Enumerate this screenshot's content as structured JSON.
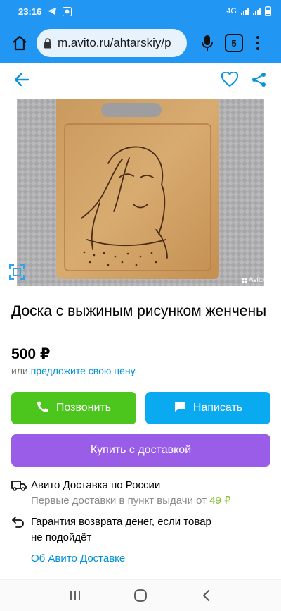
{
  "status_bar": {
    "time": "23:16",
    "network": "4G",
    "icons": [
      "telegram-icon",
      "avito-notification-icon",
      "signal-icon",
      "battery-icon"
    ]
  },
  "browser": {
    "url": "m.avito.ru/ahtarskiy/p",
    "tab_count": "5",
    "icons": [
      "home-icon",
      "lock-icon",
      "mic-icon",
      "tabs-icon",
      "menu-icon"
    ]
  },
  "header": {
    "icons": [
      "back-arrow-icon",
      "heart-icon",
      "share-icon"
    ]
  },
  "photo": {
    "watermark": "Avito",
    "icons": [
      "gallery-expand-icon"
    ]
  },
  "listing": {
    "title": "Доска с выжиным рисунком женчены",
    "price": "500 ₽",
    "offer_prefix": "или",
    "offer_link": "предложите свою цену"
  },
  "actions": {
    "call": "Позвонить",
    "write": "Написать",
    "buy": "Купить с доставкой"
  },
  "delivery": {
    "title": "Авито Доставка по России",
    "subtitle_prefix": "Первые доставки в пункт выдачи от",
    "subtitle_price": "49 ₽",
    "guarantee_line1": "Гарантия возврата денег, если товар",
    "guarantee_line2": "не подойдёт",
    "about_link": "Об Авито Доставке"
  },
  "colors": {
    "browser_blue": "#2196f3",
    "call_green": "#4cc51d",
    "write_blue": "#0aaaf1",
    "buy_purple": "#9a5de8",
    "link_blue": "#0091d5",
    "price_green": "#7fbf2a"
  }
}
